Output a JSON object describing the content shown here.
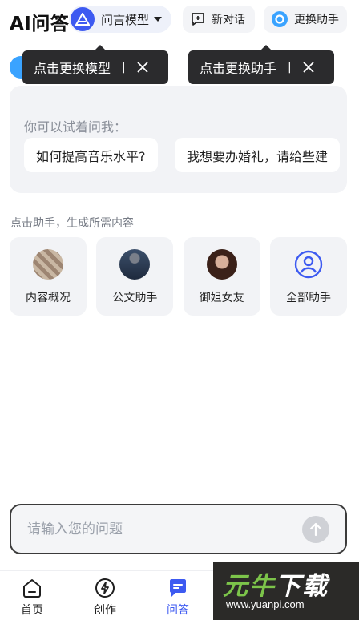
{
  "header": {
    "app_title": "AI问答",
    "model_label": "问言模型",
    "new_chat_label": "新对话",
    "switch_assistant_label": "更换助手"
  },
  "tooltips": {
    "model": "点击更换模型",
    "assistant": "点击更换助手",
    "separator": "|"
  },
  "suggestions": {
    "hint": "你可以试着问我：",
    "chips": [
      "如何提高音乐水平?",
      "我想要办婚礼，请给些建"
    ]
  },
  "assistants": {
    "section_title": "点击助手，生成所需内容",
    "items": [
      {
        "label": "内容概况",
        "icon": "content-avatar"
      },
      {
        "label": "公文助手",
        "icon": "document-avatar"
      },
      {
        "label": "御姐女友",
        "icon": "girlfriend-avatar"
      },
      {
        "label": "全部助手",
        "icon": "all-assistants-icon"
      }
    ]
  },
  "input": {
    "placeholder": "请输入您的问题",
    "value": ""
  },
  "nav": {
    "home": "首页",
    "create": "创作",
    "qa": "问答",
    "active": "qa"
  },
  "watermark": {
    "logo_green": "元",
    "logo_green2": "牛",
    "logo_white": "下载",
    "url": "www.yuanpi.com"
  },
  "colors": {
    "accent": "#3d5af1",
    "tooltip_bg": "#2b2b2d",
    "card_bg": "#f2f3f6"
  }
}
